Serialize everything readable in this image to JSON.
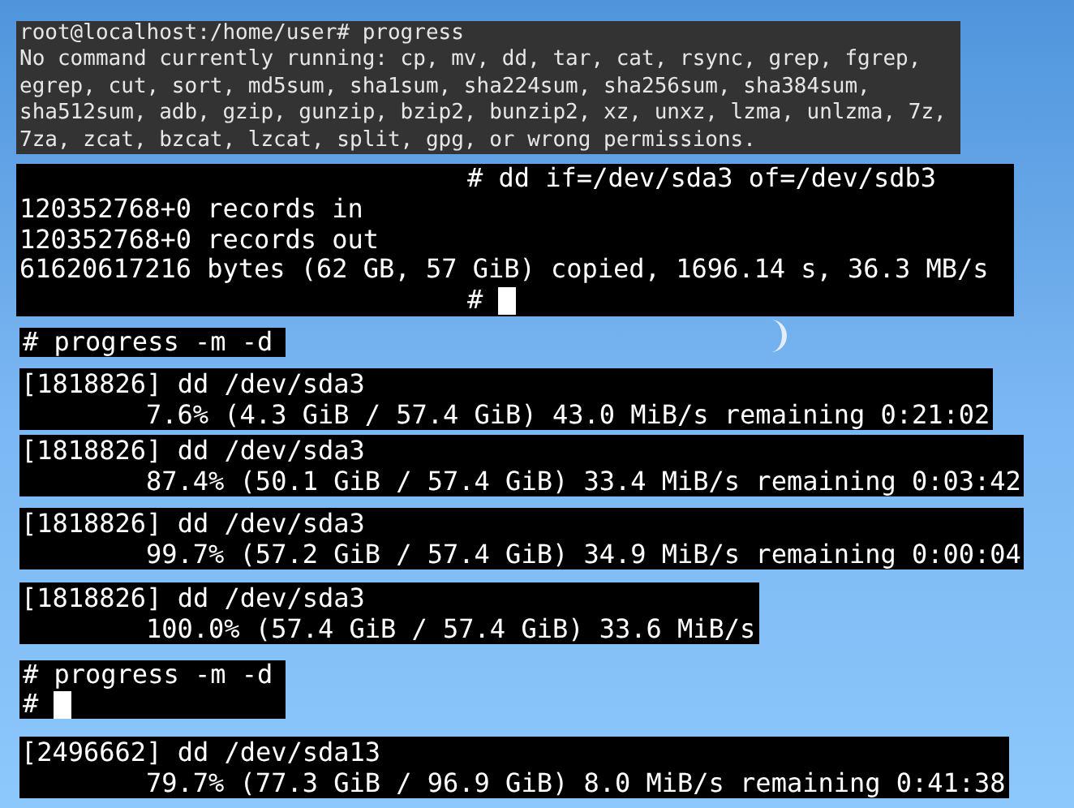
{
  "blocks": [
    {
      "kind": "session",
      "lines": [
        "root@localhost:/home/user# progress",
        "No command currently running: cp, mv, dd, tar, cat, rsync, grep, fgrep,",
        "egrep, cut, sort, md5sum, sha1sum, sha224sum, sha256sum, sha384sum,",
        "sha512sum, adb, gzip, gunzip, bzip2, bunzip2, xz, unxz, lzma, unlzma, 7z,",
        "7za, zcat, bzcat, lzcat, split, gpg, or wrong permissions."
      ]
    },
    {
      "kind": "dd",
      "command": "# dd if=/dev/sda3 of=/dev/sdb3",
      "lines": [
        "120352768+0 records in",
        "120352768+0 records out",
        "61620617216 bytes (62 GB, 57 GiB) copied, 1696.14 s, 36.3 MB/s"
      ],
      "prompt": "#",
      "cursor": true
    },
    {
      "kind": "prompt",
      "lines": [
        "# progress -m -d"
      ],
      "cursor": false
    },
    {
      "kind": "progress",
      "process": "[1818826] dd /dev/sda3",
      "stats": "7.6% (4.3 GiB / 57.4 GiB) 43.0 MiB/s remaining 0:21:02"
    },
    {
      "kind": "progress",
      "process": "[1818826] dd /dev/sda3",
      "stats": "87.4% (50.1 GiB / 57.4 GiB) 33.4 MiB/s remaining 0:03:42"
    },
    {
      "kind": "progress",
      "process": "[1818826] dd /dev/sda3",
      "stats": "99.7% (57.2 GiB / 57.4 GiB) 34.9 MiB/s remaining 0:00:04"
    },
    {
      "kind": "progress",
      "process": "[1818826] dd /dev/sda3",
      "stats": "100.0% (57.4 GiB / 57.4 GiB) 33.6 MiB/s"
    },
    {
      "kind": "prompt",
      "lines": [
        "# progress -m -d",
        "#"
      ],
      "cursor": true
    },
    {
      "kind": "progress",
      "process": "[2496662] dd /dev/sda13",
      "stats": "79.7% (77.3 GiB / 96.9 GiB) 8.0 MiB/s remaining 0:41:38"
    }
  ]
}
